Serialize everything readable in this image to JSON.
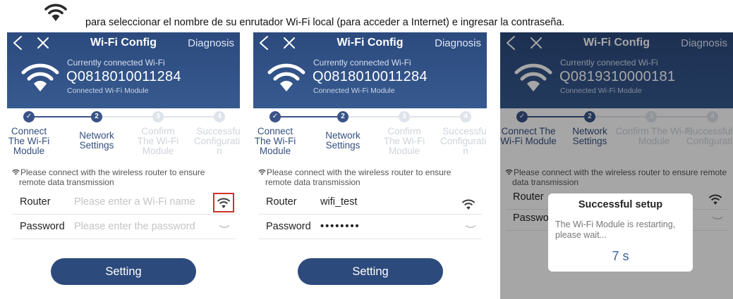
{
  "instruction": {
    "icon": "wifi-icon",
    "text": "para seleccionar el nombre de su enrutador Wi-Fi local (para acceder a Internet) e ingresar la contraseña."
  },
  "colors": {
    "header": "#2c4a7e",
    "accent": "#3a5488",
    "button": "#2d4a7c",
    "highlight_box": "#d0312d",
    "countdown": "#3a5fa0"
  },
  "screens": [
    {
      "header": {
        "back_icon": "chevron-left-icon",
        "close_icon": "close-icon",
        "title": "Wi-Fi Config",
        "diagnosis": "Diagnosis",
        "wifi_icon": "wifi-icon",
        "current_label": "Currently connected Wi-Fi",
        "module_id": "Q0818010011284",
        "module_label": "Connected Wi-Fi Module"
      },
      "steps": [
        {
          "marker": "✓",
          "label": "Connect The Wi-Fi Module",
          "state": "done"
        },
        {
          "marker": "2",
          "label": "Network Settings",
          "state": "active"
        },
        {
          "marker": "3",
          "label": "Confirm The Wi-Fi Module",
          "state": "pending"
        },
        {
          "marker": "4",
          "label": "Successful Configuratio n",
          "state": "pending"
        }
      ],
      "notice": {
        "first": "Please connect with the wireless router to ensure",
        "rest": "remote data transmission"
      },
      "router": {
        "label": "Router",
        "value": "",
        "placeholder": "Please enter a Wi-Fi name",
        "action_icon": "wifi-icon"
      },
      "password": {
        "label": "Password",
        "value": "",
        "placeholder": "Please enter the password",
        "action_icon": "eye-closed-icon"
      },
      "button": "Setting"
    },
    {
      "header": {
        "back_icon": "chevron-left-icon",
        "close_icon": "close-icon",
        "title": "Wi-Fi Config",
        "diagnosis": "Diagnosis",
        "wifi_icon": "wifi-icon",
        "current_label": "Currently connected Wi-Fi",
        "module_id": "Q0818010011284",
        "module_label": "Connected Wi-Fi Module"
      },
      "steps": [
        {
          "marker": "✓",
          "label": "Connect The Wi-Fi Module",
          "state": "done"
        },
        {
          "marker": "2",
          "label": "Network Settings",
          "state": "active"
        },
        {
          "marker": "3",
          "label": "Confirm The Wi-Fi Module",
          "state": "pending"
        },
        {
          "marker": "4",
          "label": "Successful Configuratio n",
          "state": "pending"
        }
      ],
      "notice": {
        "first": "Please connect with the wireless router to ensure",
        "rest": "remote data transmission"
      },
      "router": {
        "label": "Router",
        "value": "wifi_test",
        "placeholder": "",
        "action_icon": "wifi-icon"
      },
      "password": {
        "label": "Password",
        "value": "••••••••",
        "placeholder": "",
        "action_icon": "eye-closed-icon"
      },
      "button": "Setting"
    },
    {
      "header": {
        "back_icon": "chevron-left-icon",
        "close_icon": "close-icon",
        "title": "Wi-Fi Config",
        "diagnosis": "Diagnosis",
        "wifi_icon": "wifi-icon",
        "current_label": "Currently connected Wi-Fi",
        "module_id": "Q0819310000181",
        "module_label": "Connected Wi-Fi Module"
      },
      "steps": [
        {
          "marker": "✓",
          "label": "Connect The Wi-Fi Module",
          "state": "done"
        },
        {
          "marker": "2",
          "label": "Network Settings",
          "state": "active"
        },
        {
          "marker": "3",
          "label": "Confirm The Wi-Fi Module",
          "state": "pending"
        },
        {
          "marker": "4",
          "label": "Successful Configuratio",
          "state": "pending"
        }
      ],
      "notice": {
        "first": "Please connect with the wireless router to ensure remote",
        "rest": "data transmission"
      },
      "router": {
        "label": "Router",
        "action_icon": "wifi-icon"
      },
      "password": {
        "label": "Passwor",
        "action_icon": "eye-closed-icon"
      },
      "dialog": {
        "title": "Successful setup",
        "message": "The Wi-Fi Module is restarting, please wait...",
        "countdown": "7 s"
      }
    }
  ]
}
